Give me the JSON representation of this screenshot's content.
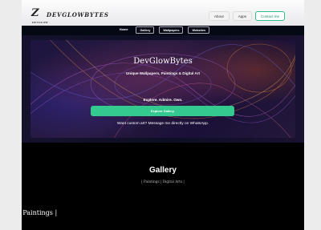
{
  "header": {
    "logo_mark": "Z",
    "logo_mark_sub": "DEVGLOW",
    "logo_text": "DEVGLOWBYTES",
    "actions": [
      {
        "label": "About",
        "style": "plain"
      },
      {
        "label": "Apps",
        "style": "plain"
      },
      {
        "label": "Contact me",
        "style": "accent"
      }
    ]
  },
  "nav": {
    "items": [
      {
        "label": "Home",
        "boxed": false
      },
      {
        "label": "Gallery",
        "boxed": true
      },
      {
        "label": "Wallpapers",
        "boxed": true
      },
      {
        "label": "Websites",
        "boxed": true
      }
    ]
  },
  "hero": {
    "title": "DevGlowBytes",
    "subtitle": "Unique Wallpapers, Paintings & Digital Art",
    "tagline": "Explore. Admire. Own.",
    "cta_label": "Explore Gallery",
    "note": "Want custom art? Message me directly on WhatsApp."
  },
  "gallery": {
    "title": "Gallery",
    "subtitle": "| Paintings | Digital Arts |",
    "section_heading": "| Paintings |"
  },
  "colors": {
    "accent": "#34c98f",
    "nav_bg": "#050914",
    "page_bg": "#000000"
  }
}
